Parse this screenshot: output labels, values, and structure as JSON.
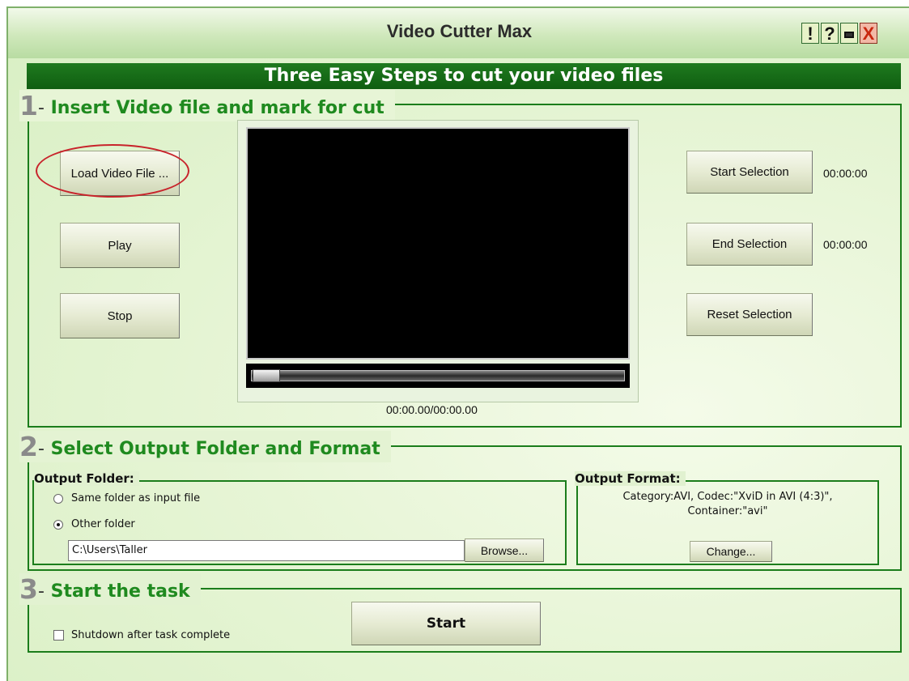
{
  "window": {
    "title": "Video Cutter Max",
    "controls": {
      "alert": "!",
      "help": "?",
      "close": "X"
    }
  },
  "banner": "Three Easy Steps to cut your video files",
  "step1": {
    "number": "1",
    "dash": "-",
    "heading": "Insert Video file and mark for cut",
    "load_button": "Load Video File ...",
    "play_button": "Play",
    "stop_button": "Stop",
    "start_selection_button": "Start Selection",
    "start_selection_time": "00:00:00",
    "end_selection_button": "End Selection",
    "end_selection_time": "00:00:00",
    "reset_selection_button": "Reset Selection",
    "playback_time": "00:00.00/00:00.00",
    "seek_position": 0
  },
  "step2": {
    "number": "2",
    "dash": "-",
    "heading": "Select Output Folder and Format",
    "output_folder": {
      "label": "Output Folder:",
      "option_same": "Same folder as input file",
      "option_other": "Other folder",
      "selected": "other",
      "path": "C:\\Users\\Taller",
      "browse_button": "Browse..."
    },
    "output_format": {
      "label": "Output Format:",
      "line1": "Category:AVI, Codec:\"XviD in AVI (4:3)\",",
      "line2": "Container:\"avi\"",
      "change_button": "Change..."
    }
  },
  "step3": {
    "number": "3",
    "dash": "-",
    "heading": "Start the task",
    "shutdown_label": "Shutdown after task complete",
    "shutdown_checked": false,
    "start_button": "Start"
  },
  "colors": {
    "accent_green": "#1f8a1f",
    "banner_green": "#0f5e10",
    "highlight_red": "#c8232b"
  }
}
